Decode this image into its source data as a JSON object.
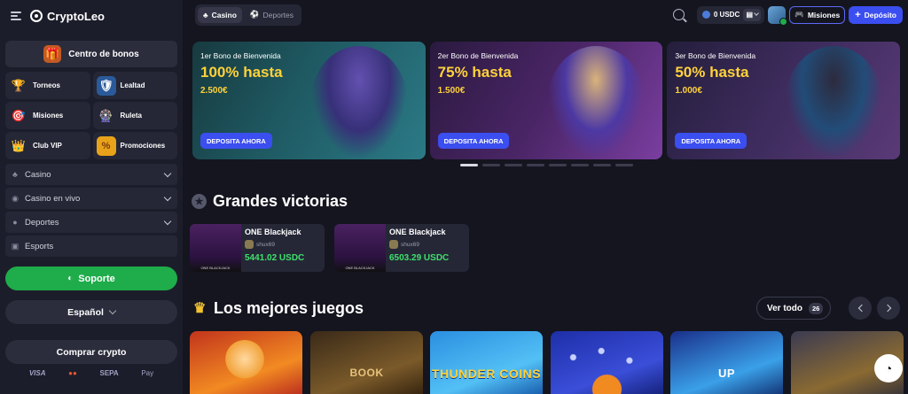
{
  "sidebar": {
    "logo": "CryptoLeo",
    "bonus_center": "Centro de bonos",
    "tiles": [
      {
        "label": "Torneos",
        "icon": "trophy-icon"
      },
      {
        "label": "Lealtad",
        "icon": "shield-icon"
      },
      {
        "label": "Misiones",
        "icon": "target-icon"
      },
      {
        "label": "Ruleta",
        "icon": "wheel-icon"
      },
      {
        "label": "Club VIP",
        "icon": "crown-icon"
      },
      {
        "label": "Promociones",
        "icon": "percent-icon"
      }
    ],
    "nav": [
      {
        "label": "Casino",
        "icon": "cherries-icon"
      },
      {
        "label": "Casino en vivo",
        "icon": "live-icon"
      },
      {
        "label": "Deportes",
        "icon": "ball-icon"
      },
      {
        "label": "Esports",
        "icon": "gamepad-icon"
      }
    ],
    "support": "Soporte",
    "language": "Español",
    "buy_crypto": "Comprar crypto",
    "payments": [
      "VISA",
      "●●",
      "SEPA",
      "Pay"
    ]
  },
  "topbar": {
    "tabs": [
      "Casino",
      "Deportes"
    ],
    "balance": "0 USDC",
    "missions": "Misiones",
    "deposit": "Depósito"
  },
  "banners": [
    {
      "subtitle": "1er Bono de Bienvenida",
      "title": "100% hasta",
      "amount": "2.500€",
      "button": "DEPOSITA AHORA"
    },
    {
      "subtitle": "2er Bono de Bienvenida",
      "title": "75% hasta",
      "amount": "1.500€",
      "button": "DEPOSITA AHORA"
    },
    {
      "subtitle": "3er Bono de Bienvenida",
      "title": "50% hasta",
      "amount": "1.000€",
      "button": "DEPOSITA AHORA"
    }
  ],
  "carousel": {
    "total": 8,
    "active": 0
  },
  "big_wins": {
    "title": "Grandes victorias",
    "items": [
      {
        "game": "ONE Blackjack",
        "user": "shux69",
        "amount": "5441.02 USDC"
      },
      {
        "game": "ONE Blackjack",
        "user": "shux69",
        "amount": "6503.29 USDC"
      }
    ]
  },
  "best_games": {
    "title": "Los mejores juegos",
    "see_all": "Ver todo",
    "count": "26",
    "games": [
      {
        "name": "",
        "text": ""
      },
      {
        "name": "",
        "text": "BOOK"
      },
      {
        "name": "",
        "text": "THUNDER COINS"
      },
      {
        "name": "",
        "text": ""
      },
      {
        "name": "",
        "text": "UP"
      },
      {
        "name": "",
        "text": ""
      }
    ]
  }
}
